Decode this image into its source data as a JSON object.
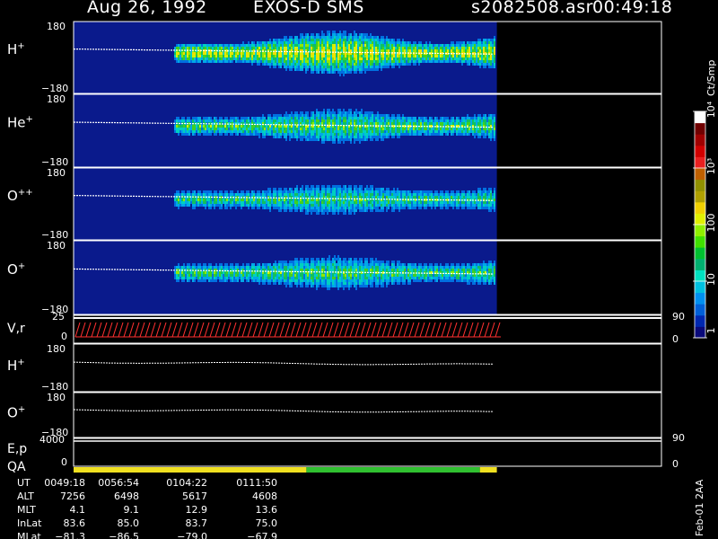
{
  "header": {
    "date": "Aug 26, 1992",
    "instrument": "EXOS-D SMS",
    "file": "s2082508.asr",
    "time": "00:49:18"
  },
  "panels": [
    {
      "label": "H",
      "sup": "+",
      "ymax": "180",
      "ymin": "−180"
    },
    {
      "label": "He",
      "sup": "+",
      "ymax": "180",
      "ymin": "−180"
    },
    {
      "label": "O",
      "sup": "++",
      "ymax": "180",
      "ymin": "−180"
    },
    {
      "label": "O",
      "sup": "+",
      "ymax": "180",
      "ymin": "−180"
    }
  ],
  "vr_panel": {
    "label": "V,r",
    "ymax": "25",
    "ymin": "0",
    "right_top": "90",
    "right_bottom": "0"
  },
  "line_panels": [
    {
      "label": "H",
      "sup": "+",
      "ymax": "180",
      "ymin": "−180"
    },
    {
      "label": "O",
      "sup": "+",
      "ymax": "180",
      "ymin": "−180"
    }
  ],
  "ep_panel": {
    "label": "E,p",
    "ymax": "4000",
    "ymin": "0",
    "right_top": "90",
    "right_bottom": "0"
  },
  "qa_panel": {
    "label": "QA"
  },
  "colorbar": {
    "title": "Ct/Smp",
    "ticks": [
      "1",
      "10",
      "100",
      "10³",
      "10⁴"
    ],
    "colors": [
      "#0a0a7a",
      "#0028b0",
      "#0060d8",
      "#0090f0",
      "#00c0e0",
      "#00e0c0",
      "#00b070",
      "#00c030",
      "#40e000",
      "#90f000",
      "#e0f000",
      "#f0d000",
      "#b0a000",
      "#909000",
      "#c06000",
      "#e82020",
      "#d00000",
      "#a00000",
      "#700000",
      "#ffffff"
    ]
  },
  "footer": {
    "rows": [
      {
        "label": "UT",
        "values": [
          "0049:18",
          "0056:54",
          "0104:22",
          "0111:50"
        ]
      },
      {
        "label": "ALT",
        "values": [
          "7256",
          "6498",
          "5617",
          "4608"
        ]
      },
      {
        "label": "MLT",
        "values": [
          "4.1",
          "9.1",
          "12.9",
          "13.6"
        ]
      },
      {
        "label": "InLat",
        "values": [
          "83.6",
          "85.0",
          "83.7",
          "75.0"
        ]
      },
      {
        "label": "MLat",
        "values": [
          "−81.3",
          "−86.5",
          "−79.0",
          "−67.9"
        ]
      }
    ],
    "stamp": "Feb-01 2AA"
  },
  "chart_data": {
    "type": "heatmap",
    "title": "Aug 26, 1992   EXOS-D SMS",
    "x_ticks": [
      "0049:18",
      "0056:54",
      "0104:22",
      "0111:50"
    ],
    "ylim": [
      -180,
      180
    ],
    "color_scale": "log",
    "color_range": [
      1,
      10000
    ],
    "series": [
      {
        "name": "H+",
        "data_fraction_of_axis": [
          0,
          0.72
        ]
      },
      {
        "name": "He+",
        "data_fraction_of_axis": [
          0,
          0.72
        ]
      },
      {
        "name": "O++",
        "data_fraction_of_axis": [
          0,
          0.72
        ]
      },
      {
        "name": "O+",
        "data_fraction_of_axis": [
          0,
          0.72
        ]
      }
    ],
    "qa_segments": [
      {
        "color": "#f0e020",
        "fraction": [
          0,
          0.55
        ]
      },
      {
        "color": "#30c030",
        "fraction": [
          0.55,
          0.96
        ]
      },
      {
        "color": "#f0e020",
        "fraction": [
          0.96,
          1
        ]
      }
    ]
  }
}
